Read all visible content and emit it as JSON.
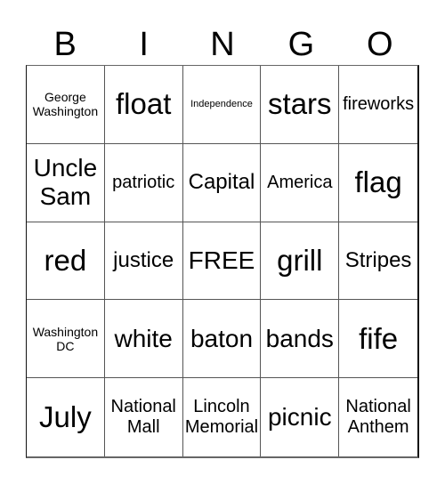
{
  "header": [
    "B",
    "I",
    "N",
    "G",
    "O"
  ],
  "cells": [
    "George Washington",
    "float",
    "Independence",
    "stars",
    "fireworks",
    "Uncle Sam",
    "patriotic",
    "Capital",
    "America",
    "flag",
    "red",
    "justice",
    "FREE",
    "grill",
    "Stripes",
    "Washington DC",
    "white",
    "baton",
    "bands",
    "fife",
    "July",
    "National Mall",
    "Lincoln Memorial",
    "picnic",
    "National Anthem"
  ]
}
